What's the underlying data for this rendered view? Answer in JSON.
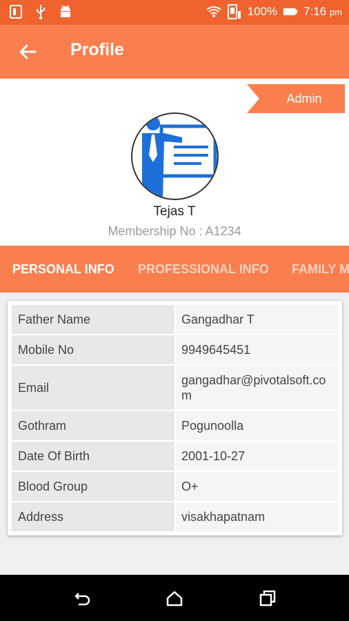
{
  "status_bar": {
    "battery": "100%",
    "time": "7:16",
    "ampm": "pm",
    "left_icons": [
      "sim-card-icon",
      "usb-icon",
      "android-icon"
    ],
    "right_icons": [
      "wifi-icon",
      "signal-icon",
      "battery-icon"
    ]
  },
  "app_bar": {
    "title": "Profile",
    "back_icon": "arrow-left-icon"
  },
  "profile": {
    "role_badge": "Admin",
    "avatar_icon": "presenter-icon",
    "name": "Tejas T",
    "membership": "Membership No : A1234"
  },
  "tabs": [
    {
      "label": "PERSONAL INFO",
      "active": true
    },
    {
      "label": "PROFESSIONAL INFO",
      "active": false
    },
    {
      "label": "FAMILY M",
      "active": false
    }
  ],
  "personal_info": [
    {
      "label": "Father Name",
      "value": "Gangadhar T"
    },
    {
      "label": "Mobile No",
      "value": "9949645451"
    },
    {
      "label": "Email",
      "value": "gangadhar@pivotalsoft.com"
    },
    {
      "label": "Gothram",
      "value": "Pogunoolla"
    },
    {
      "label": "Date Of Birth",
      "value": "2001-10-27"
    },
    {
      "label": "Blood Group",
      "value": "O+"
    },
    {
      "label": "Address",
      "value": "visakhapatnam"
    }
  ],
  "nav_bar": {
    "buttons": [
      "back-icon",
      "home-icon",
      "recents-icon"
    ]
  },
  "colors": {
    "primary": "#fb7e4e",
    "status_bar": "#f0632f",
    "label_bg": "#e8e8e8",
    "value_bg": "#f5f5f5"
  }
}
